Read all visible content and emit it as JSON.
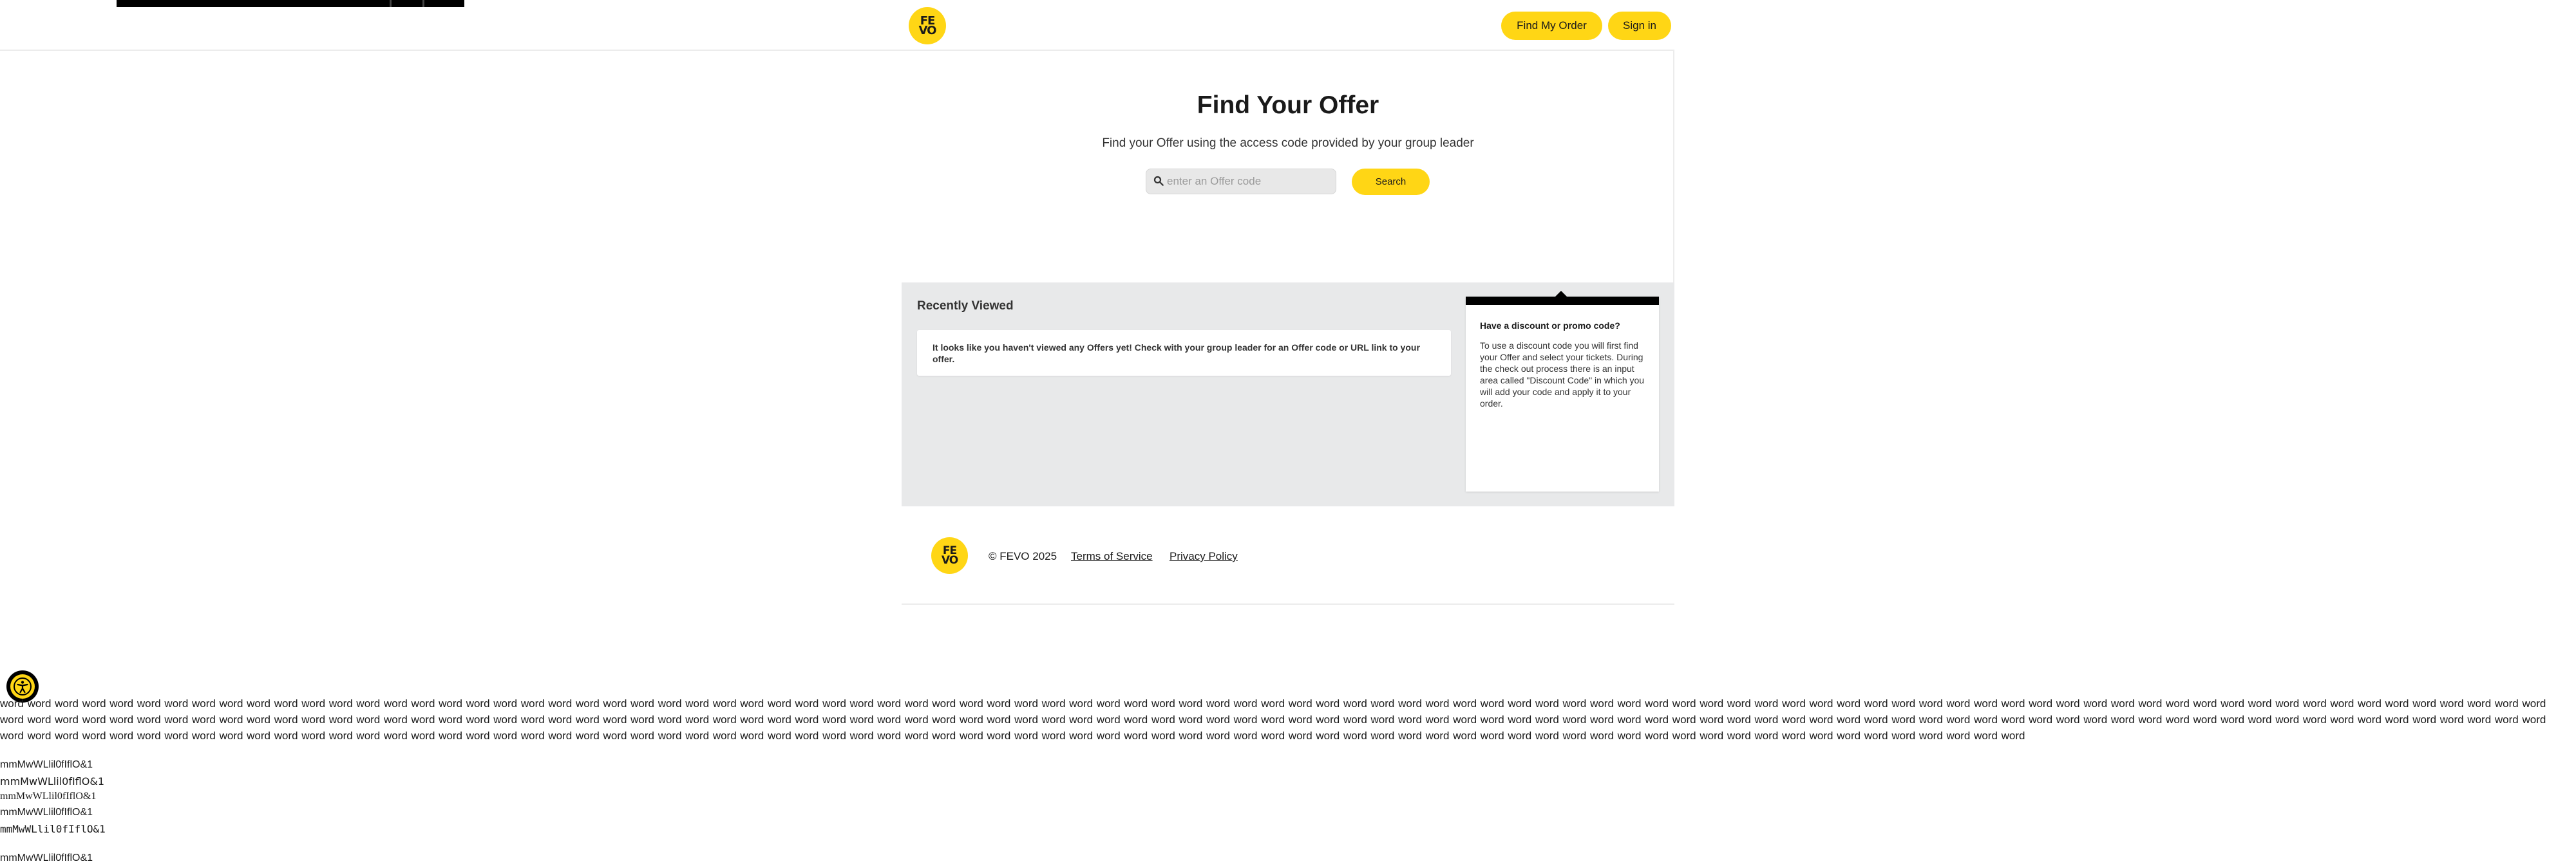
{
  "header": {
    "logo_text": "FE\nVO",
    "find_order_label": "Find My Order",
    "signin_label": "Sign in"
  },
  "hero": {
    "title": "Find Your Offer",
    "subtitle": "Find your Offer using the access code provided by your group leader",
    "search_placeholder": "enter an Offer code",
    "search_value": "",
    "search_button_label": "Search"
  },
  "recently_viewed": {
    "title": "Recently Viewed",
    "empty_message": "It looks like you haven't viewed any Offers yet! Check with your group leader for an Offer code or URL link to your offer."
  },
  "promo": {
    "title": "Have a discount or promo code?",
    "body": "To use a discount code you will first find your Offer and select your tickets. During the check out process there is an input area called \"Discount Code\" in which you will add your code and apply it to your order."
  },
  "footer": {
    "logo_text": "FE\nVO",
    "copyright": "© FEVO 2025",
    "terms_label": "Terms of Service",
    "privacy_label": "Privacy Policy"
  },
  "debug_text": {
    "word_block": "word word word word word word word word word word word word word word word word word word word word word word word word word word word word word word word word word word word word word word word word word word word word word word word word word word word word word word word word word word word word word word word word word word word word word word word word word word word word word word word word word word word word word word word word word word word word word word word word word word word word word word word word word word word word word word word word word word word word word word word word word word word word word word word word word word word word word word word word word word word word word word word word word word word word word word word word word word word word word word word word word word word word word word word word word word word word word word word word word word word word word word word word word word word word word word word word word word word word word word word word word word word word word word word word word word word word word word word word word word word word word word word word word word word word word word word word word word word word word word word word word word word word word word word word word word word word word word word word word word word word",
    "probe_1": "mmMwWLlil0fIflO&1",
    "probe_2": "mmMwWLlil0fIflO&1",
    "probe_3": "mmMwWLlil0fIflO&1",
    "probe_4": "mmMwWLlil0fIflO&1",
    "probe_5": "mmMwWLlil0fIflO&1",
    "probe_6": "mmMwWLlil0fIflO&1"
  },
  "colors": {
    "brand_yellow": "#ffd615",
    "panel_gray": "#e8e9ea",
    "text_dark": "#1a1a1a"
  },
  "icons": {
    "search": "search-icon",
    "accessibility": "accessibility-icon"
  }
}
